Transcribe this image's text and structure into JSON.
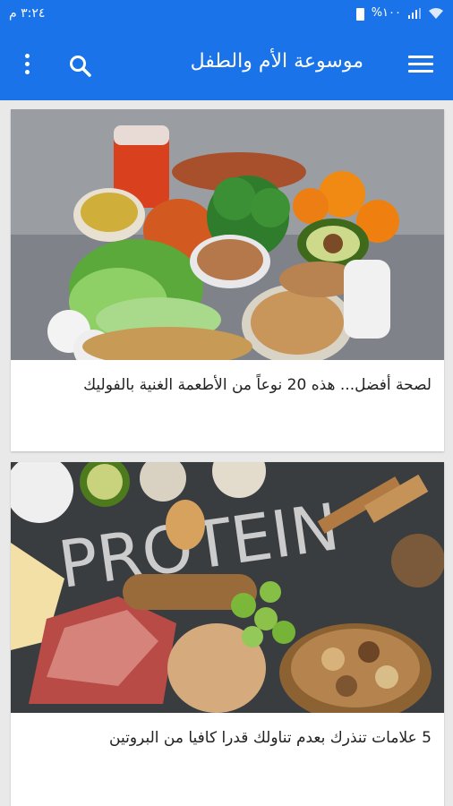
{
  "status": {
    "time": "٣:٢٤ م",
    "battery": "%١٠٠"
  },
  "appbar": {
    "title": "موسوعة الأم والطفل"
  },
  "icons": {
    "menu": "hamburger-icon",
    "search": "search-icon",
    "more": "more-vert-icon"
  },
  "colors": {
    "primary": "#1a73e8",
    "background": "#e9e9e9"
  },
  "articles": [
    {
      "title": "لصحة أفضل... هذه 20 نوعاً من الأطعمة الغنية بالفوليك"
    },
    {
      "title": "5 علامات تنذرك بعدم تناولك قدرا كافيا من البروتين"
    }
  ]
}
